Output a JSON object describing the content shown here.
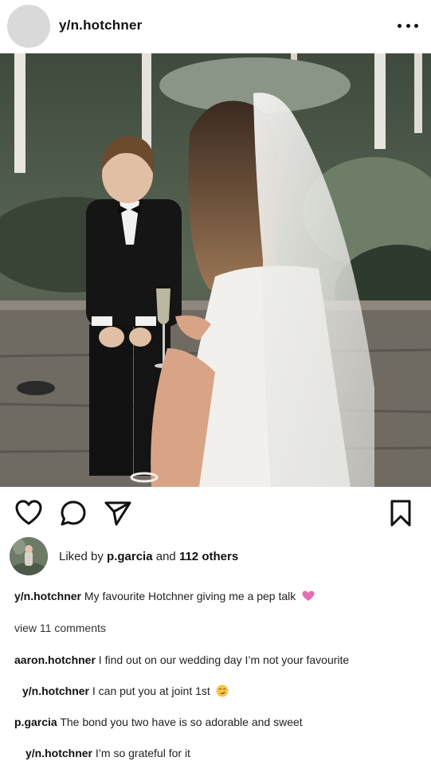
{
  "post": {
    "username": "y/n.hotchner",
    "photo_alt": "Wedding photo: boy in a tuxedo sitting beside a bride in a veil"
  },
  "actions": {
    "like_icon": "heart-outline-icon",
    "comment_icon": "comment-bubble-icon",
    "share_icon": "paper-plane-icon",
    "save_icon": "bookmark-outline-icon"
  },
  "likes": {
    "prefix": "Liked by ",
    "user": "p.garcia",
    "middle": " and ",
    "count": "112 others"
  },
  "caption": {
    "user": "y/n.hotchner",
    "text": "My favourite Hotchner giving me a pep talk",
    "emoji": "pink-heart"
  },
  "view_comments": "view 11 comments",
  "comments": [
    {
      "user": "aaron.hotchner",
      "text": "I find out on our wedding day I’m not your favourite"
    },
    {
      "user": "y/n.hotchner",
      "text": "I can put you at joint 1st",
      "emoji": "smirk"
    },
    {
      "user": "p.garcia",
      "text": "The bond you two have is so adorable and sweet"
    },
    {
      "user": "y/n.hotchner",
      "text": "I’m so grateful for it"
    }
  ],
  "colors": {
    "text": "#111111",
    "avatar_placeholder": "#d9d9d9",
    "heart_emoji": "#e46fb7"
  }
}
